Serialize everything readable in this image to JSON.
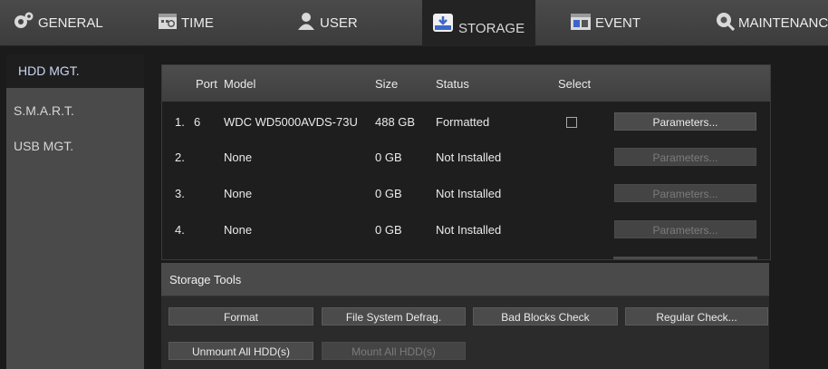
{
  "tabs": [
    {
      "label": "GENERAL",
      "icon": "gears-icon"
    },
    {
      "label": "TIME",
      "icon": "calendar-clock-icon"
    },
    {
      "label": "USER",
      "icon": "user-icon"
    },
    {
      "label": "STORAGE",
      "icon": "storage-drive-icon",
      "active": true
    },
    {
      "label": "EVENT",
      "icon": "event-calendar-icon"
    },
    {
      "label": "MAINTENANCE",
      "icon": "maintenance-gear-icon"
    }
  ],
  "sidebar": {
    "items": [
      {
        "label": "HDD MGT.",
        "active": true
      },
      {
        "label": "S.M.A.R.T."
      },
      {
        "label": "USB MGT."
      }
    ]
  },
  "table": {
    "headers": {
      "port": "Port",
      "model": "Model",
      "size": "Size",
      "status": "Status",
      "select": "Select"
    },
    "rows": [
      {
        "index": "1.",
        "port": "6",
        "model": "WDC WD5000AVDS-73U",
        "size": "488 GB",
        "status": "Formatted",
        "has_select": true,
        "button": "Parameters...",
        "enabled": true
      },
      {
        "index": "2.",
        "port": "",
        "model": "None",
        "size": "0 GB",
        "status": "Not Installed",
        "has_select": false,
        "button": "Parameters...",
        "enabled": false
      },
      {
        "index": "3.",
        "port": "",
        "model": "None",
        "size": "0 GB",
        "status": "Not Installed",
        "has_select": false,
        "button": "Parameters...",
        "enabled": false
      },
      {
        "index": "4.",
        "port": "",
        "model": "None",
        "size": "0 GB",
        "status": "Not Installed",
        "has_select": false,
        "button": "Parameters...",
        "enabled": false
      }
    ]
  },
  "tools": {
    "title": "Storage Tools",
    "format": "Format",
    "defrag": "File System Defrag.",
    "bad_blocks": "Bad Blocks Check",
    "regular_check": "Regular Check...",
    "unmount_all": "Unmount All HDD(s)",
    "mount_all": "Mount All HDD(s)"
  },
  "colors": {
    "active_sidebar_text": "#cbd5f2",
    "disabled_text": "#7b7b7b"
  }
}
